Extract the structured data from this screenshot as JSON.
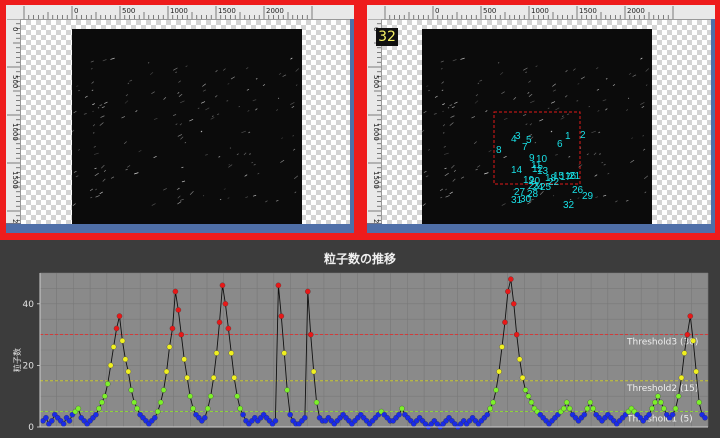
{
  "viewer": {
    "ruler_h_labels": [
      "0",
      "500",
      "1000",
      "1500",
      "2000"
    ],
    "ruler_v_labels": [
      "0",
      "500",
      "1000",
      "1500",
      "2000"
    ],
    "particle_count": "32",
    "particle_ids": [
      "1",
      "2",
      "3",
      "4",
      "5",
      "6",
      "7",
      "8",
      "9",
      "10",
      "11",
      "12",
      "13",
      "14",
      "15",
      "16",
      "17",
      "18",
      "19",
      "20",
      "21",
      "22",
      "23",
      "24",
      "25",
      "26",
      "27",
      "28",
      "29",
      "30",
      "31",
      "32"
    ]
  },
  "chart": {
    "title": "粒子数の推移",
    "ylabel": "粒子数",
    "thresholds": [
      {
        "label": "Threshold3 (30)",
        "value": 30,
        "color": "#e03030"
      },
      {
        "label": "Threshold2 (15)",
        "value": 15,
        "color": "#d0d020"
      },
      {
        "label": "Threshold1 (5)",
        "value": 5,
        "color": "#90e030"
      }
    ],
    "colors": {
      "below_t1": "#1a2be8",
      "t1_t2": "#7cf02a",
      "t2_t3": "#f0f020",
      "above_t3": "#e81818"
    }
  },
  "chart_data": {
    "type": "scatter",
    "title": "粒子数の推移",
    "xlabel": "",
    "ylabel": "粒子数",
    "ylim": [
      0,
      50
    ],
    "yticks": [
      0,
      20,
      40
    ],
    "grid": true,
    "series": [
      {
        "values": [
          2,
          3,
          1,
          2,
          4,
          3,
          2,
          1,
          3,
          2,
          4,
          5,
          6,
          3,
          2,
          1,
          2,
          3,
          4,
          6,
          8,
          10,
          14,
          20,
          26,
          32,
          36,
          28,
          22,
          18,
          12,
          8,
          6,
          4,
          3,
          2,
          1,
          2,
          3,
          5,
          8,
          12,
          18,
          26,
          32,
          44,
          38,
          30,
          22,
          16,
          10,
          6,
          4,
          3,
          2,
          3,
          6,
          10,
          16,
          24,
          34,
          46,
          40,
          32,
          24,
          16,
          10,
          6,
          4,
          2,
          1,
          2,
          3,
          2,
          3,
          4,
          3,
          2,
          1,
          2,
          46,
          36,
          24,
          12,
          4,
          2,
          1,
          1,
          2,
          3,
          44,
          30,
          18,
          8,
          3,
          2,
          2,
          3,
          2,
          1,
          2,
          3,
          4,
          3,
          2,
          1,
          2,
          3,
          4,
          3,
          2,
          1,
          2,
          3,
          4,
          5,
          4,
          3,
          2,
          2,
          3,
          4,
          6,
          4,
          3,
          2,
          1,
          2,
          3,
          2,
          1,
          0,
          1,
          2,
          1,
          0,
          1,
          2,
          3,
          2,
          1,
          0,
          1,
          2,
          1,
          2,
          3,
          2,
          1,
          2,
          3,
          4,
          6,
          8,
          12,
          18,
          26,
          34,
          44,
          48,
          40,
          30,
          22,
          16,
          12,
          10,
          8,
          6,
          5,
          4,
          3,
          2,
          1,
          2,
          3,
          4,
          5,
          6,
          8,
          6,
          4,
          3,
          2,
          3,
          4,
          6,
          8,
          6,
          4,
          3,
          2,
          3,
          4,
          3,
          2,
          1,
          2,
          3,
          4,
          5,
          6,
          5,
          4,
          3,
          2,
          3,
          4,
          6,
          8,
          10,
          8,
          6,
          4,
          3,
          4,
          6,
          10,
          16,
          24,
          30,
          36,
          28,
          18,
          8,
          4,
          3
        ]
      }
    ]
  }
}
